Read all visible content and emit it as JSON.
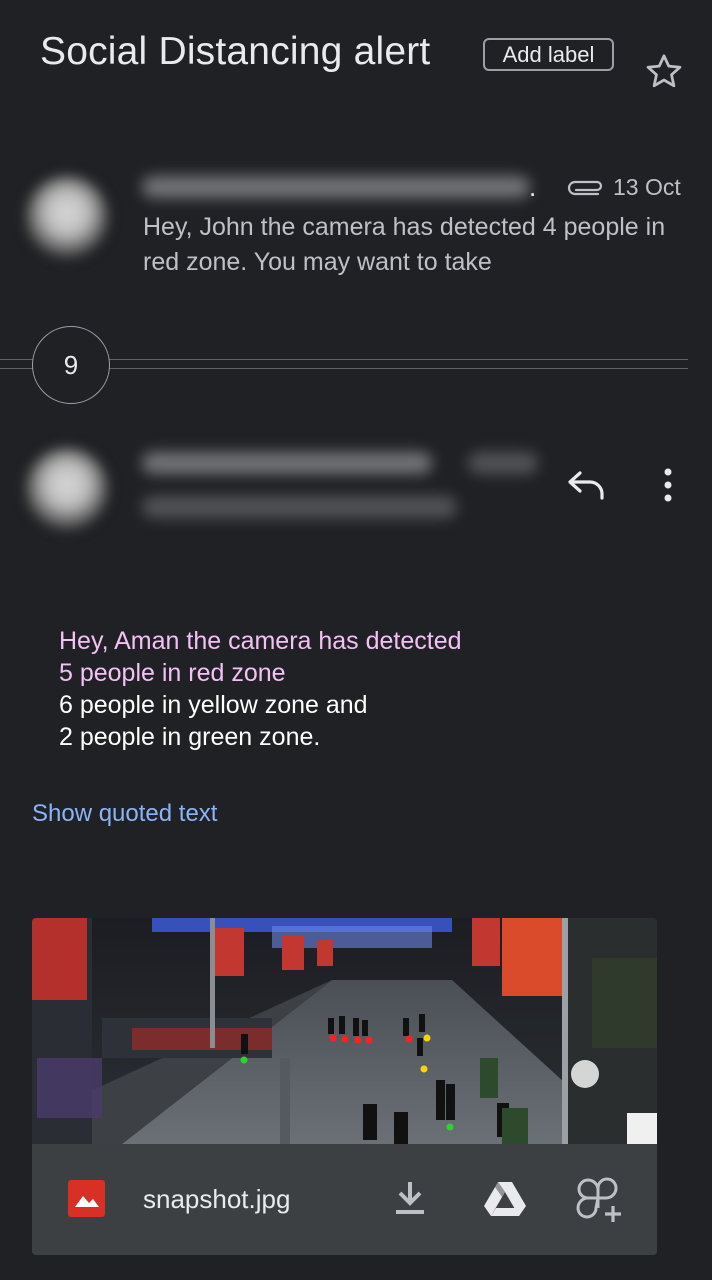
{
  "subject": "Social Distancing alert",
  "add_label": "Add label",
  "message1": {
    "ellipsis": ".",
    "date": "13 Oct",
    "snippet": "Hey, John the camera has detected 4 people in red zone. You may want to take"
  },
  "collapsed_count": "9",
  "message2": {
    "body_lines_highlighted": [
      "Hey, Aman the camera has detected",
      "5 people in red zone"
    ],
    "body_lines": [
      "6 people in yellow zone and",
      "2 people in green zone."
    ],
    "show_quoted": "Show quoted text"
  },
  "attachment": {
    "filename": "snapshot.jpg"
  },
  "icons": {
    "star": "star-outline-icon",
    "clip": "paperclip-icon",
    "reply": "reply-icon",
    "more": "more-vert-icon",
    "image": "image-file-icon",
    "download": "download-icon",
    "drive": "drive-icon",
    "photos": "add-to-photos-icon"
  },
  "colors": {
    "background": "#202124",
    "highlight_text": "#f3c1f5",
    "link": "#8ab4f8",
    "attachment_bar": "#3c4043",
    "image_icon": "#d93025"
  }
}
